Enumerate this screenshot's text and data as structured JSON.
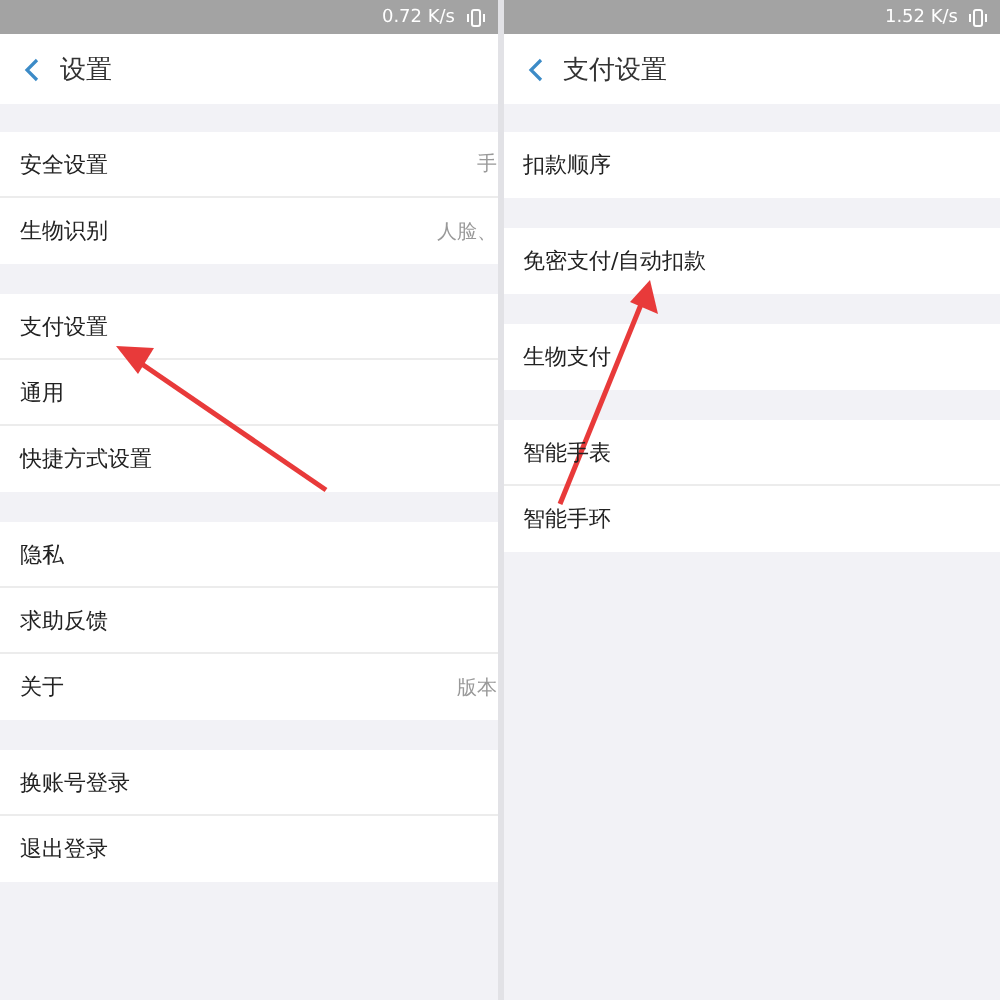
{
  "panels": [
    {
      "status_speed": "0.72 K/s",
      "title": "设置",
      "groups": [
        [
          {
            "label": "安全设置",
            "value": "手"
          },
          {
            "label": "生物识别",
            "value": "人脸、"
          }
        ],
        [
          {
            "label": "支付设置"
          },
          {
            "label": "通用"
          },
          {
            "label": "快捷方式设置"
          }
        ],
        [
          {
            "label": "隐私"
          },
          {
            "label": "求助反馈"
          },
          {
            "label": "关于",
            "value": "版本"
          }
        ],
        [
          {
            "label": "换账号登录"
          },
          {
            "label": "退出登录"
          }
        ]
      ]
    },
    {
      "status_speed": "1.52 K/s",
      "title": "支付设置",
      "groups": [
        [
          {
            "label": "扣款顺序"
          }
        ],
        [
          {
            "label": "免密支付/自动扣款"
          }
        ],
        [
          {
            "label": "生物支付"
          }
        ],
        [
          {
            "label": "智能手表"
          },
          {
            "label": "智能手环"
          }
        ]
      ]
    }
  ]
}
